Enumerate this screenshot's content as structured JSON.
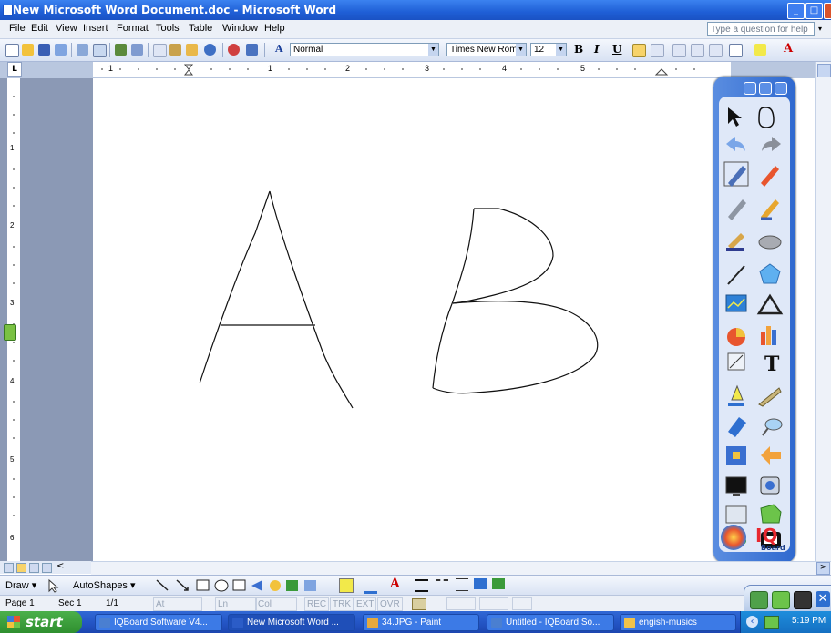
{
  "window": {
    "title": "New Microsoft Word Document.doc - Microsoft Word",
    "controls": {
      "minimize": "_",
      "maximize": "□"
    }
  },
  "menu": {
    "items": [
      "File",
      "Edit",
      "View",
      "Insert",
      "Format",
      "Tools",
      "Table",
      "Window",
      "Help"
    ],
    "help_placeholder": "Type a question for help"
  },
  "toolbar": {
    "style": "Normal",
    "font": "Times New Roman",
    "size": "12",
    "bold": "B",
    "italic": "I",
    "underline": "U"
  },
  "ruler": {
    "corner": "L",
    "numbers": [
      "1",
      "1",
      "2",
      "3",
      "4",
      "5"
    ],
    "vnumbers": [
      "1",
      "2",
      "3",
      "4",
      "5",
      "6"
    ]
  },
  "document": {
    "drawn_letters": [
      "A",
      "B"
    ]
  },
  "drawing_toolbar": {
    "draw_label": "Draw ▾",
    "autoshapes_label": "AutoShapes ▾"
  },
  "status_bar": {
    "page": "Page 1",
    "sec": "Sec 1",
    "pages": "1/1",
    "at": "At",
    "ln": "Ln",
    "col": "Col",
    "rec": "REC",
    "trk": "TRK",
    "ext": "EXT",
    "ovr": "OVR"
  },
  "iqboard": {
    "logo": "IQ",
    "logo_sub": "Board"
  },
  "taskbar": {
    "start": "start",
    "tasks": [
      {
        "label": "IQBoard Software V4...",
        "color": "#4a7fd1"
      },
      {
        "label": "New Microsoft Word ...",
        "color": "#2b5cc7"
      },
      {
        "label": "34.JPG - Paint",
        "color": "#e6a93d"
      },
      {
        "label": "Untitled - IQBoard So...",
        "color": "#4a7fd1"
      },
      {
        "label": "engish-musics",
        "color": "#f0c24a"
      }
    ],
    "clock": "5:19 PM"
  }
}
